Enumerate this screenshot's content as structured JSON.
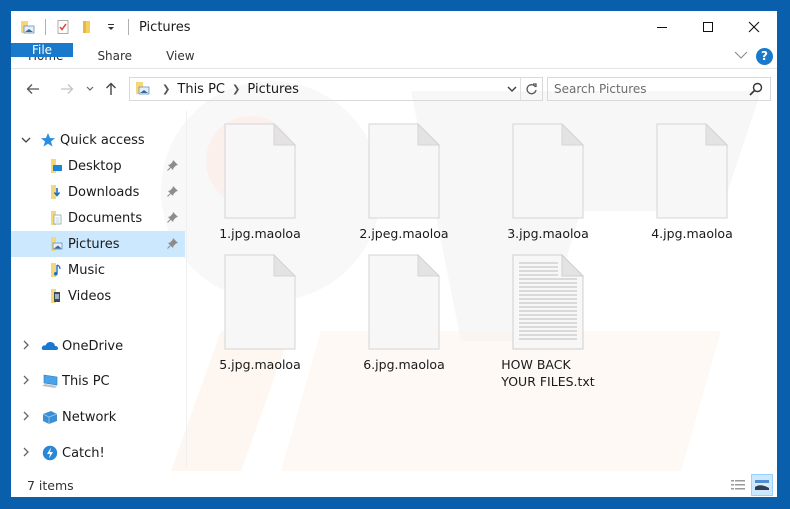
{
  "window": {
    "title": "Pictures",
    "controls": {
      "minimize": "minimize",
      "maximize": "maximize",
      "close": "close"
    }
  },
  "ribbon": {
    "tabs": [
      {
        "label": "File",
        "active": true
      },
      {
        "label": "Home"
      },
      {
        "label": "Share"
      },
      {
        "label": "View"
      }
    ],
    "help_label": "?"
  },
  "navigation": {
    "back": "back",
    "forward": "forward",
    "recent": "recent locations",
    "up": "up"
  },
  "address": {
    "breadcrumbs": [
      "This PC",
      "Pictures"
    ]
  },
  "search": {
    "placeholder": "Search Pictures",
    "value": ""
  },
  "sidebar": {
    "quick_access": {
      "label": "Quick access",
      "items": [
        {
          "label": "Desktop",
          "icon": "desktop-folder-icon",
          "pinned": true
        },
        {
          "label": "Downloads",
          "icon": "downloads-folder-icon",
          "pinned": true
        },
        {
          "label": "Documents",
          "icon": "documents-folder-icon",
          "pinned": true
        },
        {
          "label": "Pictures",
          "icon": "pictures-folder-icon",
          "pinned": true,
          "selected": true
        },
        {
          "label": "Music",
          "icon": "music-folder-icon",
          "pinned": false
        },
        {
          "label": "Videos",
          "icon": "videos-folder-icon",
          "pinned": false
        }
      ]
    },
    "roots": [
      {
        "label": "OneDrive",
        "icon": "onedrive-icon"
      },
      {
        "label": "This PC",
        "icon": "this-pc-icon"
      },
      {
        "label": "Network",
        "icon": "network-icon"
      },
      {
        "label": "Catch!",
        "icon": "catch-icon"
      }
    ]
  },
  "files": [
    {
      "name": "1.jpg.maoloa",
      "type": "blank"
    },
    {
      "name": "2.jpeg.maoloa",
      "type": "blank"
    },
    {
      "name": "3.jpg.maoloa",
      "type": "blank"
    },
    {
      "name": "4.jpg.maoloa",
      "type": "blank"
    },
    {
      "name": "5.jpg.maoloa",
      "type": "blank"
    },
    {
      "name": "6.jpg.maoloa",
      "type": "blank"
    },
    {
      "name_line1": "HOW BACK",
      "name_line2": "YOUR FILES.txt",
      "type": "text"
    }
  ],
  "status": {
    "item_count": "7 items",
    "views": [
      "details",
      "large-icons"
    ],
    "active_view": "large-icons"
  },
  "colors": {
    "accent": "#1979ca",
    "frame": "#0a5fad",
    "selection": "#cce8ff"
  }
}
